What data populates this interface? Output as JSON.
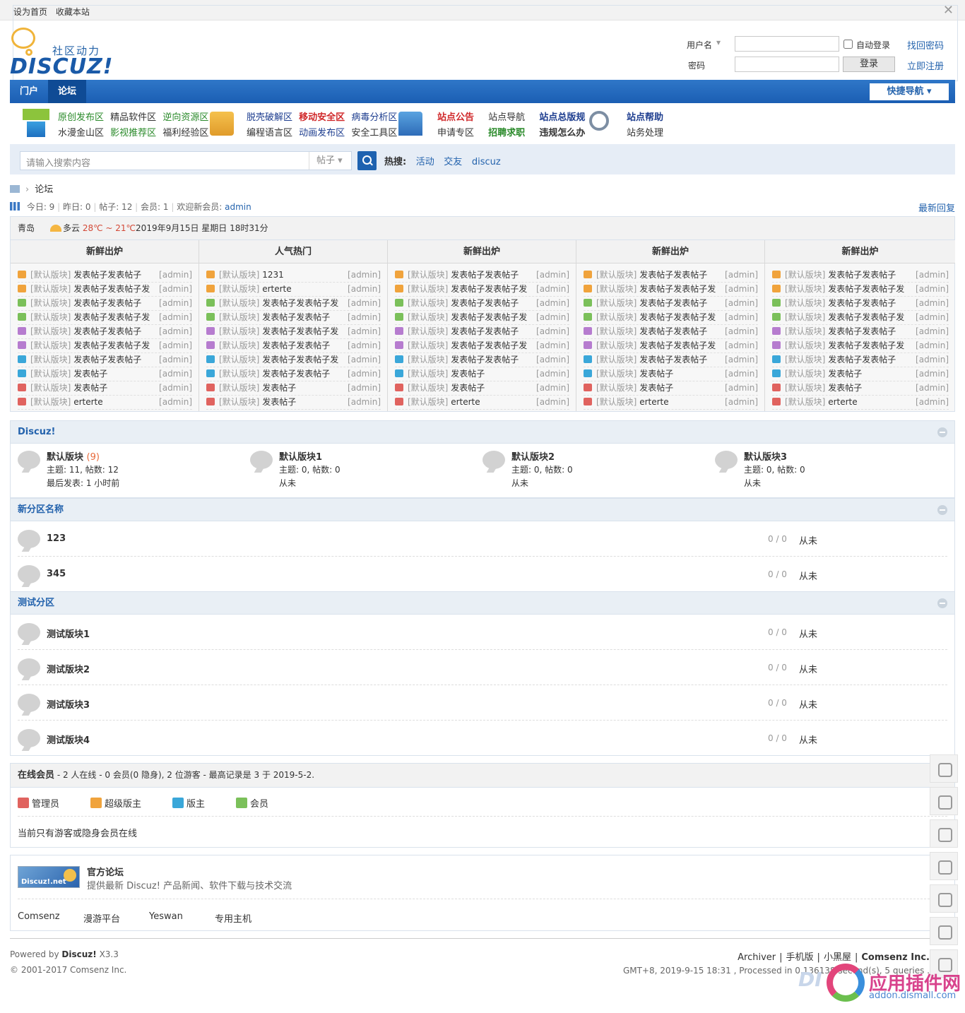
{
  "topbar": {
    "set_home": "设为首页",
    "bookmark": "收藏本站",
    "close": "✕"
  },
  "header": {
    "logo_slogan": "社区动力",
    "logo_word": "DISCUZ!",
    "login": {
      "username_label": "用户名",
      "password_label": "密码",
      "auto_login": "自动登录",
      "find_password": "找回密码",
      "register": "立即注册",
      "login_button": "登录"
    }
  },
  "nav": {
    "items": [
      {
        "label": "门户"
      },
      {
        "label": "论坛"
      }
    ],
    "quick_nav": "快捷导航"
  },
  "subnav": {
    "groups": [
      {
        "row1": [
          "原创发布区",
          "精品软件区",
          "逆向资源区"
        ],
        "row2": [
          "水漫金山区",
          "影视推荐区",
          "福利经验区"
        ]
      },
      {
        "row1": [
          "脱壳破解区",
          "移动安全区",
          "病毒分析区"
        ],
        "row2": [
          "编程语言区",
          "动画发布区",
          "安全工具区"
        ]
      },
      {
        "row1": [
          "站点公告",
          "站点导航",
          "站点总版规"
        ],
        "row2": [
          "申请专区",
          "招聘求职",
          "违规怎么办"
        ]
      },
      {
        "row1": [
          "站点帮助"
        ],
        "row2": [
          "站务处理"
        ]
      }
    ],
    "colors": {
      "green": "#2a8a2a",
      "red": "#d0282a",
      "navy": "#1d3d8f",
      "dark": "#333333",
      "blue": "#2463ad"
    }
  },
  "search": {
    "placeholder": "请输入搜索内容",
    "type": "帖子",
    "hot_label": "热搜:",
    "hot_items": [
      "活动",
      "交友",
      "discuz"
    ]
  },
  "breadcrumb": {
    "current": "论坛"
  },
  "stats": {
    "today": "今日: 9",
    "yesterday": "昨日: 0",
    "posts": "帖子: 12",
    "members": "会员: 1",
    "welcome": "欢迎新会员:",
    "newest": "admin",
    "latest_reply": "最新回复"
  },
  "weather": {
    "city": "青岛",
    "condition": "多云",
    "temp": "28℃ ~ 21℃",
    "datetime": "2019年9月15日 星期日 18时31分"
  },
  "hot_columns": [
    {
      "title": "新鲜出炉",
      "posts": [
        {
          "forum": "[默认版块]",
          "title": "发表帖子发表帖子",
          "author": "[admin]"
        },
        {
          "forum": "[默认版块]",
          "title": "发表帖子发表帖子发",
          "author": "[admin]"
        },
        {
          "forum": "[默认版块]",
          "title": "发表帖子发表帖子",
          "author": "[admin]"
        },
        {
          "forum": "[默认版块]",
          "title": "发表帖子发表帖子发",
          "author": "[admin]"
        },
        {
          "forum": "[默认版块]",
          "title": "发表帖子发表帖子",
          "author": "[admin]"
        },
        {
          "forum": "[默认版块]",
          "title": "发表帖子发表帖子发",
          "author": "[admin]"
        },
        {
          "forum": "[默认版块]",
          "title": "发表帖子发表帖子",
          "author": "[admin]"
        },
        {
          "forum": "[默认版块]",
          "title": "发表帖子",
          "author": "[admin]"
        },
        {
          "forum": "[默认版块]",
          "title": "发表帖子",
          "author": "[admin]"
        },
        {
          "forum": "[默认版块]",
          "title": "erterte",
          "author": "[admin]"
        }
      ]
    },
    {
      "title": "人气热门",
      "posts": [
        {
          "forum": "[默认版块]",
          "title": "1231",
          "author": "[admin]"
        },
        {
          "forum": "[默认版块]",
          "title": "erterte",
          "author": "[admin]"
        },
        {
          "forum": "[默认版块]",
          "title": "发表帖子发表帖子发",
          "author": "[admin]"
        },
        {
          "forum": "[默认版块]",
          "title": "发表帖子发表帖子",
          "author": "[admin]"
        },
        {
          "forum": "[默认版块]",
          "title": "发表帖子发表帖子发",
          "author": "[admin]"
        },
        {
          "forum": "[默认版块]",
          "title": "发表帖子发表帖子",
          "author": "[admin]"
        },
        {
          "forum": "[默认版块]",
          "title": "发表帖子发表帖子发",
          "author": "[admin]"
        },
        {
          "forum": "[默认版块]",
          "title": "发表帖子发表帖子",
          "author": "[admin]"
        },
        {
          "forum": "[默认版块]",
          "title": "发表帖子",
          "author": "[admin]"
        },
        {
          "forum": "[默认版块]",
          "title": "发表帖子",
          "author": "[admin]"
        }
      ]
    },
    {
      "title": "新鲜出炉",
      "posts": [
        {
          "forum": "[默认版块]",
          "title": "发表帖子发表帖子",
          "author": "[admin]"
        },
        {
          "forum": "[默认版块]",
          "title": "发表帖子发表帖子发",
          "author": "[admin]"
        },
        {
          "forum": "[默认版块]",
          "title": "发表帖子发表帖子",
          "author": "[admin]"
        },
        {
          "forum": "[默认版块]",
          "title": "发表帖子发表帖子发",
          "author": "[admin]"
        },
        {
          "forum": "[默认版块]",
          "title": "发表帖子发表帖子",
          "author": "[admin]"
        },
        {
          "forum": "[默认版块]",
          "title": "发表帖子发表帖子发",
          "author": "[admin]"
        },
        {
          "forum": "[默认版块]",
          "title": "发表帖子发表帖子",
          "author": "[admin]"
        },
        {
          "forum": "[默认版块]",
          "title": "发表帖子",
          "author": "[admin]"
        },
        {
          "forum": "[默认版块]",
          "title": "发表帖子",
          "author": "[admin]"
        },
        {
          "forum": "[默认版块]",
          "title": "erterte",
          "author": "[admin]"
        }
      ]
    },
    {
      "title": "新鲜出炉",
      "posts": [
        {
          "forum": "[默认版块]",
          "title": "发表帖子发表帖子",
          "author": "[admin]"
        },
        {
          "forum": "[默认版块]",
          "title": "发表帖子发表帖子发",
          "author": "[admin]"
        },
        {
          "forum": "[默认版块]",
          "title": "发表帖子发表帖子",
          "author": "[admin]"
        },
        {
          "forum": "[默认版块]",
          "title": "发表帖子发表帖子发",
          "author": "[admin]"
        },
        {
          "forum": "[默认版块]",
          "title": "发表帖子发表帖子",
          "author": "[admin]"
        },
        {
          "forum": "[默认版块]",
          "title": "发表帖子发表帖子发",
          "author": "[admin]"
        },
        {
          "forum": "[默认版块]",
          "title": "发表帖子发表帖子",
          "author": "[admin]"
        },
        {
          "forum": "[默认版块]",
          "title": "发表帖子",
          "author": "[admin]"
        },
        {
          "forum": "[默认版块]",
          "title": "发表帖子",
          "author": "[admin]"
        },
        {
          "forum": "[默认版块]",
          "title": "erterte",
          "author": "[admin]"
        }
      ]
    },
    {
      "title": "新鲜出炉",
      "posts": [
        {
          "forum": "[默认版块]",
          "title": "发表帖子发表帖子",
          "author": "[admin]"
        },
        {
          "forum": "[默认版块]",
          "title": "发表帖子发表帖子发",
          "author": "[admin]"
        },
        {
          "forum": "[默认版块]",
          "title": "发表帖子发表帖子",
          "author": "[admin]"
        },
        {
          "forum": "[默认版块]",
          "title": "发表帖子发表帖子发",
          "author": "[admin]"
        },
        {
          "forum": "[默认版块]",
          "title": "发表帖子发表帖子",
          "author": "[admin]"
        },
        {
          "forum": "[默认版块]",
          "title": "发表帖子发表帖子发",
          "author": "[admin]"
        },
        {
          "forum": "[默认版块]",
          "title": "发表帖子发表帖子",
          "author": "[admin]"
        },
        {
          "forum": "[默认版块]",
          "title": "发表帖子",
          "author": "[admin]"
        },
        {
          "forum": "[默认版块]",
          "title": "发表帖子",
          "author": "[admin]"
        },
        {
          "forum": "[默认版块]",
          "title": "erterte",
          "author": "[admin]"
        }
      ]
    }
  ],
  "rank_colors": [
    "#f0a33c",
    "#f0a33c",
    "#7bc05a",
    "#7bc05a",
    "#b67ccf",
    "#b67ccf",
    "#3aa7d9",
    "#3aa7d9",
    "#e0635f",
    "#e0635f"
  ],
  "groups": {
    "discuz": {
      "title": "Discuz!",
      "forums": [
        {
          "name": "默认版块",
          "today": "(9)",
          "stats": "主题: 11, 帖数: 12",
          "last": "最后发表: 1 小时前"
        },
        {
          "name": "默认版块1",
          "today": "",
          "stats": "主题: 0, 帖数: 0",
          "last": "从未"
        },
        {
          "name": "默认版块2",
          "today": "",
          "stats": "主题: 0, 帖数: 0",
          "last": "从未"
        },
        {
          "name": "默认版块3",
          "today": "",
          "stats": "主题: 0, 帖数: 0",
          "last": "从未"
        }
      ]
    },
    "new_zone": {
      "title": "新分区名称",
      "forums": [
        {
          "name": "123",
          "count": "0 / 0",
          "last": "从未"
        },
        {
          "name": "345",
          "count": "0 / 0",
          "last": "从未"
        }
      ]
    },
    "test_zone": {
      "title": "测试分区",
      "forums": [
        {
          "name": "测试版块1",
          "count": "0 / 0",
          "last": "从未"
        },
        {
          "name": "测试版块2",
          "count": "0 / 0",
          "last": "从未"
        },
        {
          "name": "测试版块3",
          "count": "0 / 0",
          "last": "从未"
        },
        {
          "name": "测试版块4",
          "count": "0 / 0",
          "last": "从未"
        }
      ]
    }
  },
  "online": {
    "title": "在线会员",
    "summary": " - 2 人在线 - 0 会员(0 隐身), 2 位游客 - 最高记录是 3 于 2019-5-2.",
    "legend": [
      {
        "label": "管理员",
        "color": "#e0635f"
      },
      {
        "label": "超级版主",
        "color": "#f0a33c"
      },
      {
        "label": "版主",
        "color": "#3aa7d9"
      },
      {
        "label": "会员",
        "color": "#7bc05a"
      }
    ],
    "message": "当前只有游客或隐身会员在线"
  },
  "friend_links": {
    "logo_text": "Discuz!.net",
    "title": "官方论坛",
    "desc": "提供最新 Discuz! 产品新闻、软件下载与技术交流",
    "text_links": [
      "Comsenz",
      "漫游平台",
      "Yeswan",
      "专用主机"
    ]
  },
  "footer": {
    "powered": "Powered by",
    "brand": "Discuz!",
    "version": "X3.3",
    "copyright": "© 2001-2017 Comsenz Inc.",
    "links": [
      "Archiver",
      "手机版",
      "小黑屋"
    ],
    "company": "Comsenz Inc.",
    "processed": "GMT+8, 2019-9-15 18:31 , Processed in 0.136138 second(s), 5 queries ."
  },
  "watermark": {
    "prefix": "DI",
    "name": "应用插件网",
    "url": "addon.dismall.com"
  },
  "side_tools": [
    "calendar-icon",
    "search-icon",
    "qq-icon",
    "share-icon",
    "wechat-icon",
    "qrcode-icon",
    "user-icon"
  ]
}
